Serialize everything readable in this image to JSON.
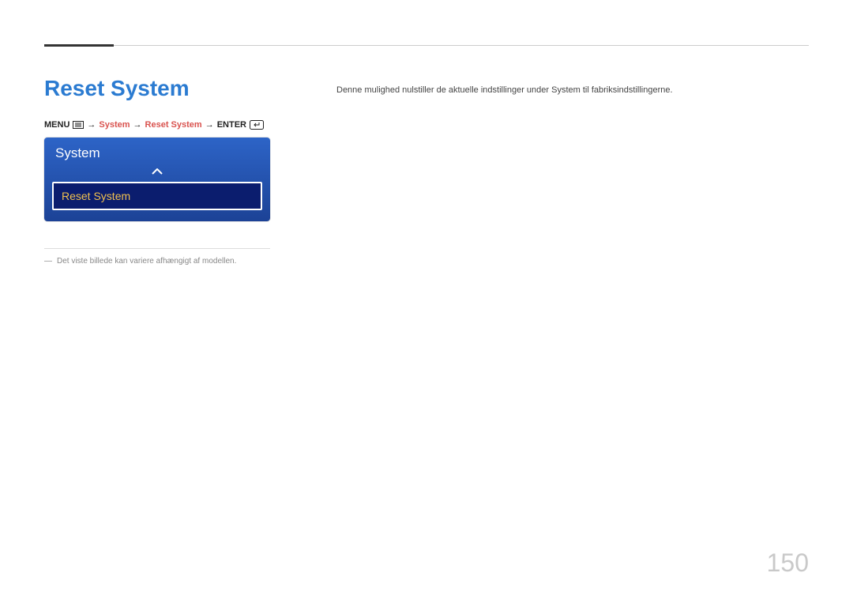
{
  "heading": "Reset System",
  "breadcrumb": {
    "menu_label": "MENU",
    "menu_icon": "menu-icon",
    "arrow": "→",
    "system": "System",
    "reset_system": "Reset System",
    "enter_label": "ENTER",
    "enter_icon": "enter-icon"
  },
  "menu": {
    "header": "System",
    "chevron": "chevron-up-icon",
    "selected_item": "Reset System"
  },
  "footnote": {
    "dash": "―",
    "text": "Det viste billede kan variere afhængigt af modellen."
  },
  "body_text": "Denne mulighed nulstiller de aktuelle indstillinger under System til fabriksindstillingerne.",
  "page_number": "150"
}
